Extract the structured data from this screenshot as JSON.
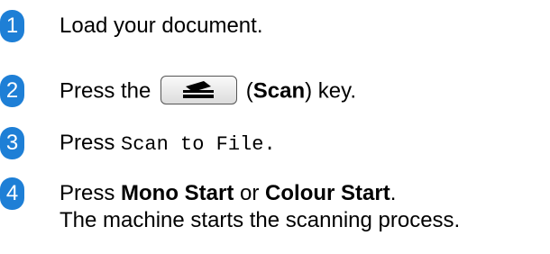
{
  "steps": [
    {
      "number": "1",
      "text": "Load your document."
    },
    {
      "number": "2",
      "before": "Press the",
      "open_paren": "(",
      "key_label": "Scan",
      "after": ") key.",
      "key_icon": "scan-key-icon"
    },
    {
      "number": "3",
      "before": "Press ",
      "mono": "Scan to File",
      "after": "."
    },
    {
      "number": "4",
      "before": "Press ",
      "bold1": "Mono Start",
      "middle": " or ",
      "bold2": "Colour Start",
      "after": ".",
      "line2": "The machine starts the scanning process."
    }
  ],
  "colors": {
    "step_badge": "#1e7fd6",
    "text": "#000000"
  }
}
